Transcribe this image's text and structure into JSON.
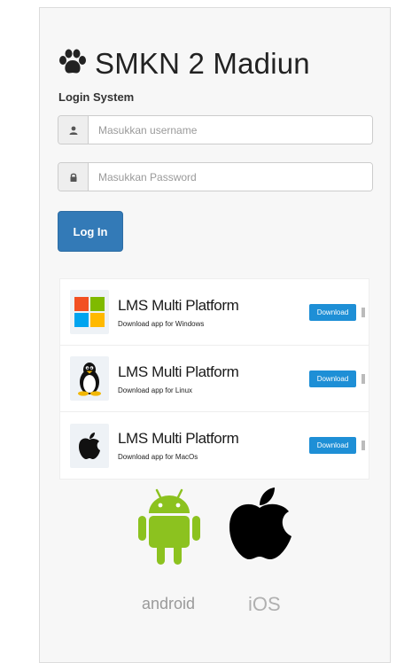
{
  "header": {
    "title": "SMKN 2 Madiun",
    "subtitle": "Login System"
  },
  "form": {
    "username_placeholder": "Masukkan username",
    "password_placeholder": "Masukkan Password",
    "login_label": "Log In"
  },
  "apps": [
    {
      "title": "LMS Multi Platform",
      "subtitle": "Download app for Windows",
      "button": "Download",
      "icon": "windows-icon"
    },
    {
      "title": "LMS Multi Platform",
      "subtitle": "Download app for Linux",
      "button": "Download",
      "icon": "linux-icon"
    },
    {
      "title": "LMS Multi Platform",
      "subtitle": "Download app for MacOs",
      "button": "Download",
      "icon": "apple-icon"
    }
  ],
  "platforms": {
    "android_label": "android",
    "ios_label": "iOS"
  },
  "colors": {
    "primary": "#337ab7",
    "download": "#1e8fd6",
    "android_green": "#8cc21f"
  }
}
